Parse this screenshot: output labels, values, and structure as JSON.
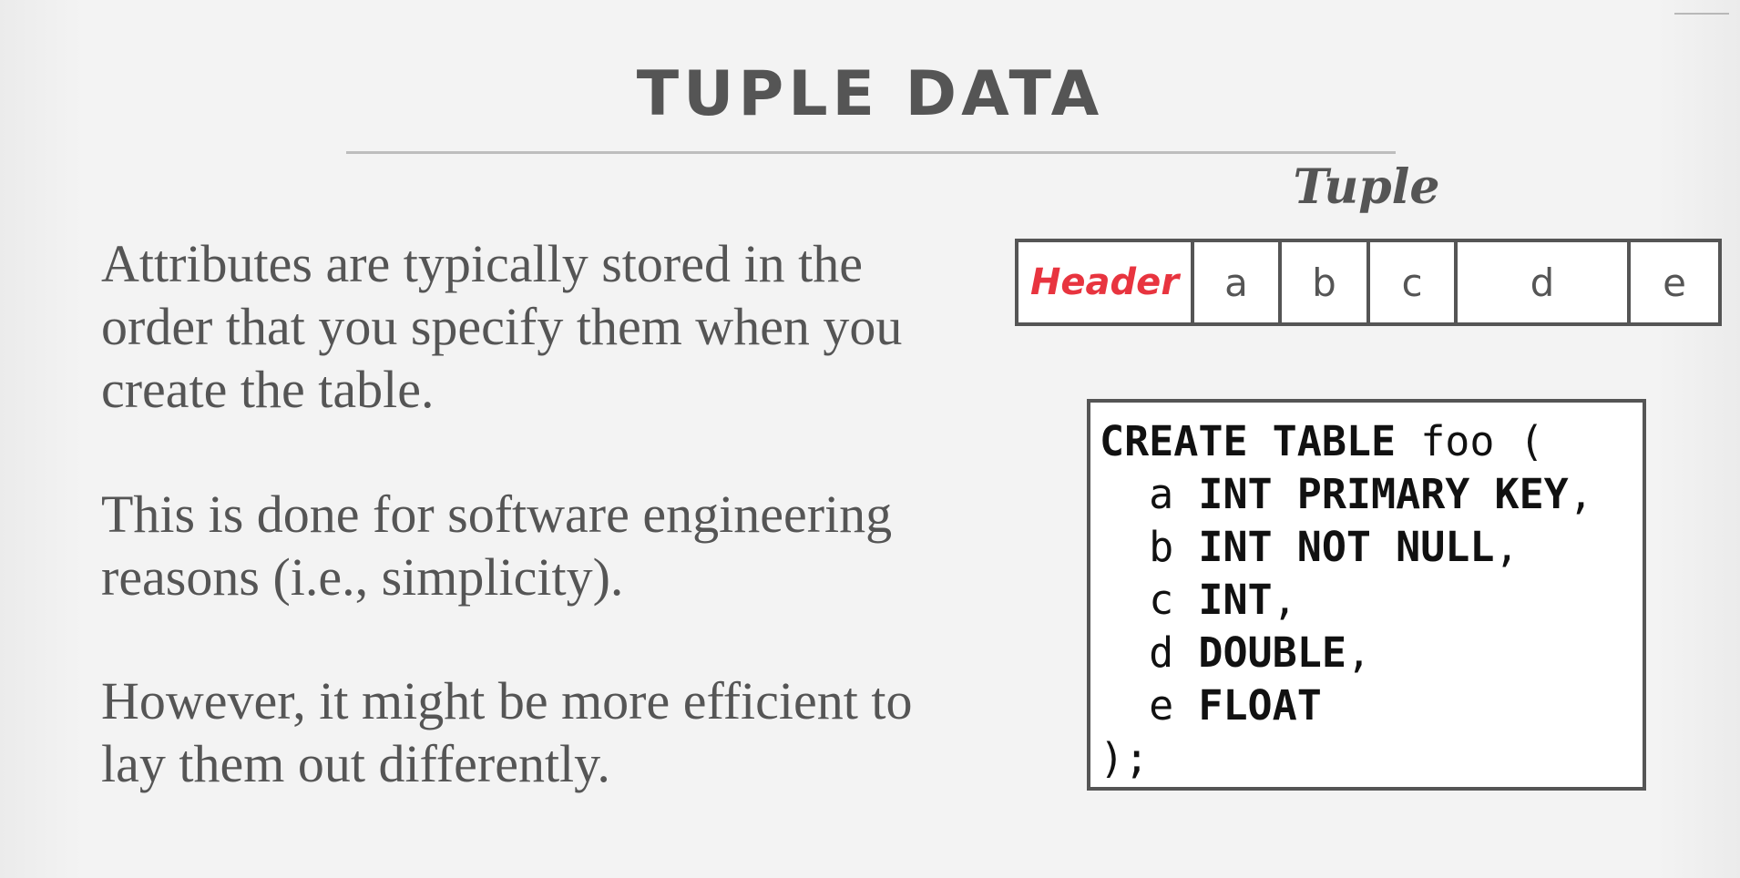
{
  "slide": {
    "title": "TUPLE DATA",
    "paragraphs": [
      "Attributes are typically stored in the order that you specify them when you create the table.",
      "This is done for software engineering reasons (i.e., simplicity).",
      "However, it might be more efficient to lay them out differently."
    ]
  },
  "tuple": {
    "label": "Tuple",
    "cells": [
      "Header",
      "a",
      "b",
      "c",
      "d",
      "e"
    ],
    "header_color": "#e8343f"
  },
  "code": {
    "lines": [
      {
        "kw1": "CREATE TABLE",
        "plain": " foo ("
      },
      {
        "name": "  a ",
        "kw": "INT PRIMARY KEY",
        "tail": ","
      },
      {
        "name": "  b ",
        "kw": "INT NOT NULL",
        "tail": ","
      },
      {
        "name": "  c ",
        "kw": "INT",
        "tail": ","
      },
      {
        "name": "  d ",
        "kw": "DOUBLE",
        "tail": ","
      },
      {
        "name": "  e ",
        "kw": "FLOAT",
        "tail": ""
      },
      {
        "plain": ");"
      }
    ]
  }
}
